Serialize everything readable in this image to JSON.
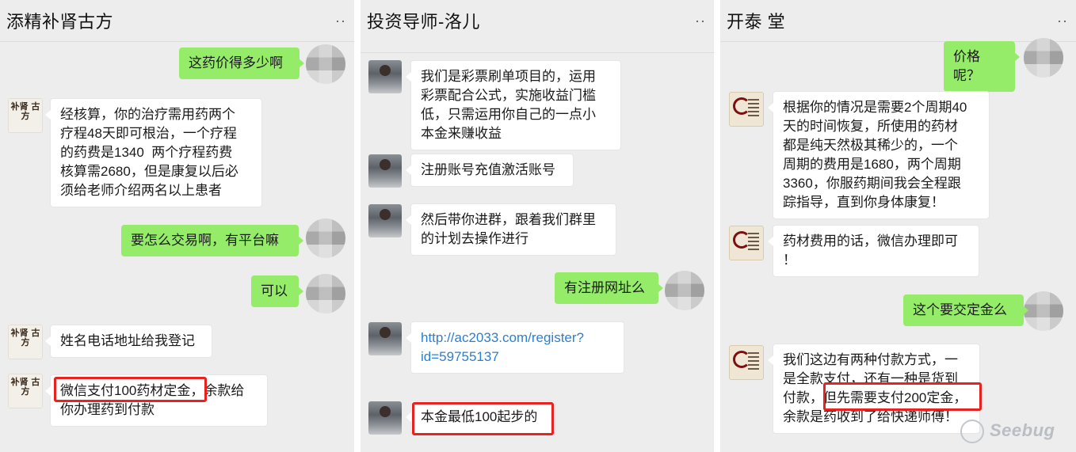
{
  "panels": [
    {
      "title": "添精补肾古方",
      "menu": "··",
      "messages": [
        "这药价得多少啊",
        "经核算，你的治疗需用药两个\n疗程48天即可根治，一个疗程\n的药费是1340  两个疗程药费\n核算需2680，但是康复以后必\n须给老师介绍两名以上患者",
        "要怎么交易啊，有平台嘛",
        "可以",
        "姓名电话地址给我登记",
        "微信支付100药材定金，余款给\n你办理药到付款"
      ],
      "avatar_text": "补肾\n古方"
    },
    {
      "title": "投资导师-洛儿",
      "menu": "··",
      "messages": [
        "我们是彩票刷单项目的，运用\n彩票配合公式，实施收益门槛\n低，只需运用你自己的一点小\n本金来赚收益",
        "注册账号充值激活账号",
        "然后带你进群，跟着我们群里\n的计划去操作进行",
        "有注册网址么",
        "http://ac2033.com/register?\nid=59755137",
        "本金最低100起步的"
      ]
    },
    {
      "title": "开泰 堂",
      "menu": "··",
      "messages": [
        "价格呢？",
        "根据你的情况是需要2个周期40\n天的时间恢复，所使用的药材\n都是纯天然极其稀少的，一个\n周期的费用是1680，两个周期\n3360，你服药期间我会全程跟\n踪指导，直到你身体康复！",
        "药材费用的话，微信办理即可\n！",
        "这个要交定金么",
        "我们这边有两种付款方式，一\n是全款支付，还有一种是货到\n付款，但先需要支付200定金，\n余款是药收到了给快递师傅！"
      ]
    }
  ],
  "watermark": "Seebug"
}
